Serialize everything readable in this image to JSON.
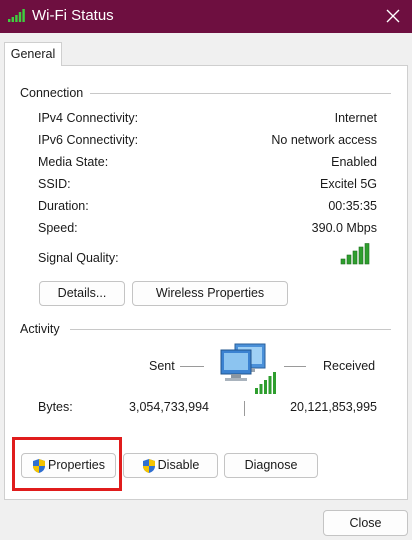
{
  "window": {
    "title": "Wi-Fi Status",
    "title_icon": "wifi-signal-icon",
    "close_icon": "close-icon"
  },
  "tabs": [
    {
      "label": "General",
      "selected": true
    }
  ],
  "connection": {
    "heading": "Connection",
    "rows": [
      {
        "label": "IPv4 Connectivity:",
        "value": "Internet"
      },
      {
        "label": "IPv6 Connectivity:",
        "value": "No network access"
      },
      {
        "label": "Media State:",
        "value": "Enabled"
      },
      {
        "label": "SSID:",
        "value": "Excitel 5G"
      },
      {
        "label": "Duration:",
        "value": "00:35:35"
      },
      {
        "label": "Speed:",
        "value": "390.0 Mbps"
      }
    ],
    "signal_quality_label": "Signal Quality:",
    "signal_bars": 5,
    "signal_bars_max": 5,
    "buttons": {
      "details": "Details...",
      "wireless_properties": "Wireless Properties"
    }
  },
  "activity": {
    "heading": "Activity",
    "sent_label": "Sent",
    "received_label": "Received",
    "bytes_label": "Bytes:",
    "sent_bytes": "3,054,733,994",
    "received_bytes": "20,121,853,995"
  },
  "action_buttons": {
    "properties": "Properties",
    "disable": "Disable",
    "diagnose": "Diagnose"
  },
  "footer": {
    "close": "Close"
  },
  "colors": {
    "titlebar": "#6e0f40",
    "signal_green": "#2e9e2e",
    "highlight_border": "#e01c1c",
    "shield_blue": "#2f6fd1",
    "shield_yellow": "#f5c400"
  }
}
